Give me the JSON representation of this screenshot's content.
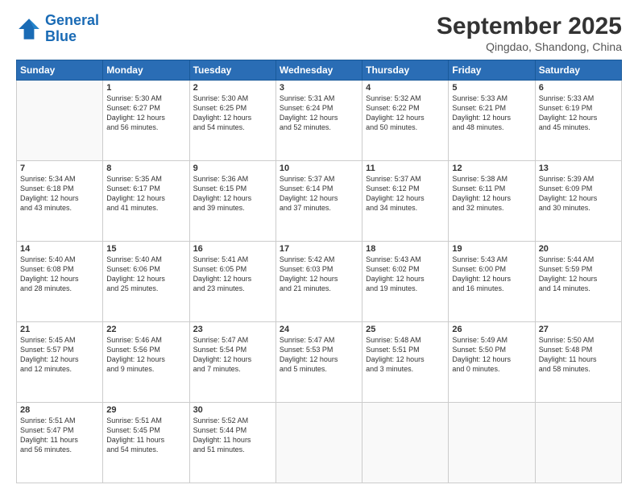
{
  "header": {
    "logo_line1": "General",
    "logo_line2": "Blue",
    "month": "September 2025",
    "location": "Qingdao, Shandong, China"
  },
  "weekdays": [
    "Sunday",
    "Monday",
    "Tuesday",
    "Wednesday",
    "Thursday",
    "Friday",
    "Saturday"
  ],
  "weeks": [
    [
      {
        "day": "",
        "info": ""
      },
      {
        "day": "1",
        "info": "Sunrise: 5:30 AM\nSunset: 6:27 PM\nDaylight: 12 hours\nand 56 minutes."
      },
      {
        "day": "2",
        "info": "Sunrise: 5:30 AM\nSunset: 6:25 PM\nDaylight: 12 hours\nand 54 minutes."
      },
      {
        "day": "3",
        "info": "Sunrise: 5:31 AM\nSunset: 6:24 PM\nDaylight: 12 hours\nand 52 minutes."
      },
      {
        "day": "4",
        "info": "Sunrise: 5:32 AM\nSunset: 6:22 PM\nDaylight: 12 hours\nand 50 minutes."
      },
      {
        "day": "5",
        "info": "Sunrise: 5:33 AM\nSunset: 6:21 PM\nDaylight: 12 hours\nand 48 minutes."
      },
      {
        "day": "6",
        "info": "Sunrise: 5:33 AM\nSunset: 6:19 PM\nDaylight: 12 hours\nand 45 minutes."
      }
    ],
    [
      {
        "day": "7",
        "info": "Sunrise: 5:34 AM\nSunset: 6:18 PM\nDaylight: 12 hours\nand 43 minutes."
      },
      {
        "day": "8",
        "info": "Sunrise: 5:35 AM\nSunset: 6:17 PM\nDaylight: 12 hours\nand 41 minutes."
      },
      {
        "day": "9",
        "info": "Sunrise: 5:36 AM\nSunset: 6:15 PM\nDaylight: 12 hours\nand 39 minutes."
      },
      {
        "day": "10",
        "info": "Sunrise: 5:37 AM\nSunset: 6:14 PM\nDaylight: 12 hours\nand 37 minutes."
      },
      {
        "day": "11",
        "info": "Sunrise: 5:37 AM\nSunset: 6:12 PM\nDaylight: 12 hours\nand 34 minutes."
      },
      {
        "day": "12",
        "info": "Sunrise: 5:38 AM\nSunset: 6:11 PM\nDaylight: 12 hours\nand 32 minutes."
      },
      {
        "day": "13",
        "info": "Sunrise: 5:39 AM\nSunset: 6:09 PM\nDaylight: 12 hours\nand 30 minutes."
      }
    ],
    [
      {
        "day": "14",
        "info": "Sunrise: 5:40 AM\nSunset: 6:08 PM\nDaylight: 12 hours\nand 28 minutes."
      },
      {
        "day": "15",
        "info": "Sunrise: 5:40 AM\nSunset: 6:06 PM\nDaylight: 12 hours\nand 25 minutes."
      },
      {
        "day": "16",
        "info": "Sunrise: 5:41 AM\nSunset: 6:05 PM\nDaylight: 12 hours\nand 23 minutes."
      },
      {
        "day": "17",
        "info": "Sunrise: 5:42 AM\nSunset: 6:03 PM\nDaylight: 12 hours\nand 21 minutes."
      },
      {
        "day": "18",
        "info": "Sunrise: 5:43 AM\nSunset: 6:02 PM\nDaylight: 12 hours\nand 19 minutes."
      },
      {
        "day": "19",
        "info": "Sunrise: 5:43 AM\nSunset: 6:00 PM\nDaylight: 12 hours\nand 16 minutes."
      },
      {
        "day": "20",
        "info": "Sunrise: 5:44 AM\nSunset: 5:59 PM\nDaylight: 12 hours\nand 14 minutes."
      }
    ],
    [
      {
        "day": "21",
        "info": "Sunrise: 5:45 AM\nSunset: 5:57 PM\nDaylight: 12 hours\nand 12 minutes."
      },
      {
        "day": "22",
        "info": "Sunrise: 5:46 AM\nSunset: 5:56 PM\nDaylight: 12 hours\nand 9 minutes."
      },
      {
        "day": "23",
        "info": "Sunrise: 5:47 AM\nSunset: 5:54 PM\nDaylight: 12 hours\nand 7 minutes."
      },
      {
        "day": "24",
        "info": "Sunrise: 5:47 AM\nSunset: 5:53 PM\nDaylight: 12 hours\nand 5 minutes."
      },
      {
        "day": "25",
        "info": "Sunrise: 5:48 AM\nSunset: 5:51 PM\nDaylight: 12 hours\nand 3 minutes."
      },
      {
        "day": "26",
        "info": "Sunrise: 5:49 AM\nSunset: 5:50 PM\nDaylight: 12 hours\nand 0 minutes."
      },
      {
        "day": "27",
        "info": "Sunrise: 5:50 AM\nSunset: 5:48 PM\nDaylight: 11 hours\nand 58 minutes."
      }
    ],
    [
      {
        "day": "28",
        "info": "Sunrise: 5:51 AM\nSunset: 5:47 PM\nDaylight: 11 hours\nand 56 minutes."
      },
      {
        "day": "29",
        "info": "Sunrise: 5:51 AM\nSunset: 5:45 PM\nDaylight: 11 hours\nand 54 minutes."
      },
      {
        "day": "30",
        "info": "Sunrise: 5:52 AM\nSunset: 5:44 PM\nDaylight: 11 hours\nand 51 minutes."
      },
      {
        "day": "",
        "info": ""
      },
      {
        "day": "",
        "info": ""
      },
      {
        "day": "",
        "info": ""
      },
      {
        "day": "",
        "info": ""
      }
    ]
  ]
}
